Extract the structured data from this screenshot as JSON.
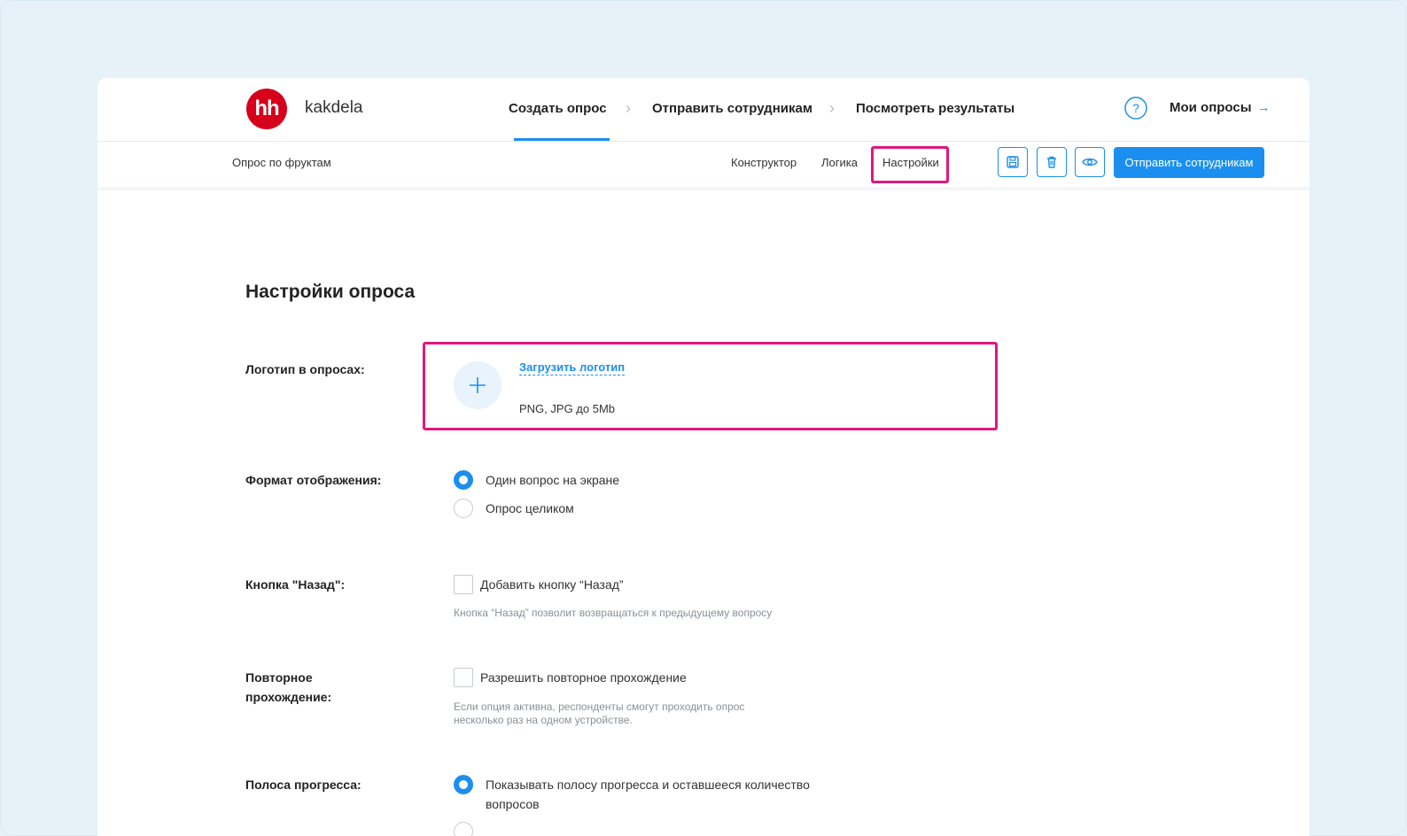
{
  "brand": {
    "logo_text": "hh",
    "name": "kakdela"
  },
  "steps": [
    {
      "label": "Создать опрос"
    },
    {
      "label": "Отправить сотрудникам"
    },
    {
      "label": "Посмотреть результаты"
    }
  ],
  "header": {
    "help_label": "?",
    "my_surveys": "Мои опросы",
    "my_surveys_arrow": "→"
  },
  "subbar": {
    "survey_name": "Опрос по фруктам",
    "tabs": [
      {
        "label": "Конструктор"
      },
      {
        "label": "Логика"
      },
      {
        "label": "Настройки"
      }
    ],
    "send_button": "Отправить сотрудникам"
  },
  "settings": {
    "title": "Настройки опроса",
    "logo": {
      "label": "Логотип в опросах:",
      "upload_link": "Загрузить логотип",
      "hint": "PNG, JPG до 5Mb"
    },
    "display_format": {
      "label": "Формат отображения:",
      "options": [
        {
          "text": "Один вопрос на экране",
          "selected": true
        },
        {
          "text": "Опрос целиком",
          "selected": false
        }
      ]
    },
    "back_button": {
      "label": "Кнопка \"Назад\":",
      "checkbox": "Добавить кнопку “Назад”",
      "checked": false,
      "hint": "Кнопка “Назад” позволит возвращаться к предыдущему вопросу"
    },
    "repeat": {
      "label_line1": "Повторное",
      "label_line2": "прохождение:",
      "checkbox": "Разрешить повторное прохождение",
      "checked": false,
      "hint_line1": "Если опция активна, респонденты смогут проходить опрос",
      "hint_line2": "несколько раз на одном устройстве."
    },
    "progress": {
      "label": "Полоса прогресса:",
      "option_line1": "Показывать полосу прогресса и оставшееся количество",
      "option_line2": "вопросов",
      "selected": true
    }
  },
  "colors": {
    "accent": "#1b8ff0",
    "highlight": "#e0177f",
    "brand_red": "#d6001c"
  }
}
